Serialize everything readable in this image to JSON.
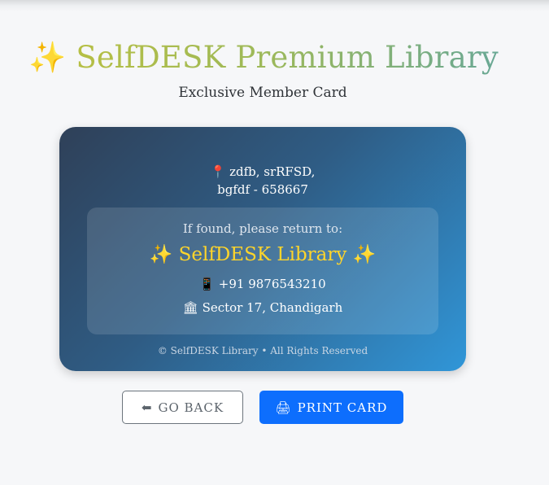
{
  "header": {
    "sparkle_icon": "✨",
    "title": "SelfDESK Premium Library",
    "subtitle": "Exclusive Member Card"
  },
  "card": {
    "address_icon": "📍",
    "address_line1": "zdfb, srRFSD,",
    "address_line2": "bgfdf - 658667",
    "return_label": "If found, please return to:",
    "library_name": "✨ SelfDESK Library ✨",
    "phone_icon": "📱",
    "phone": "+91 9876543210",
    "location_icon": "🏛",
    "location": "Sector 17, Chandigarh",
    "copyright": "© SelfDESK Library • All Rights Reserved"
  },
  "actions": {
    "back_icon": "⬅",
    "back_label": "GO BACK",
    "print_icon": "🖨",
    "print_label": "PRINT CARD"
  },
  "colors": {
    "title_gradient": [
      "#b6bf44",
      "#69a895"
    ],
    "card_gradient": [
      "#2f4058",
      "#3096d8"
    ],
    "library_name": "#ffd52a",
    "print_button": "#0d6efd",
    "back_border": "#6c757d"
  }
}
